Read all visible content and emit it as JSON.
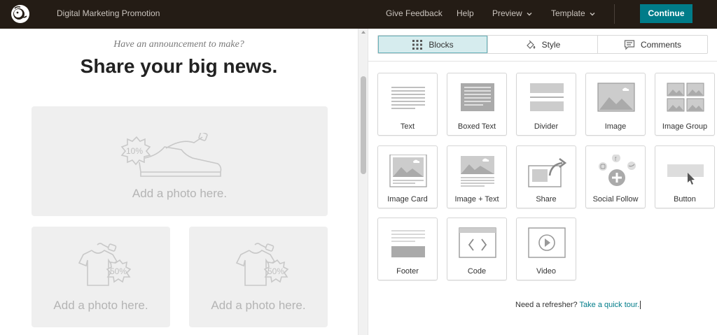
{
  "topbar": {
    "logo_icon": "mailchimp-logo-icon",
    "app_title": "Digital Marketing Promotion",
    "nav": {
      "give_feedback": "Give Feedback",
      "help": "Help",
      "preview": "Preview",
      "template": "Template"
    },
    "continue_label": "Continue",
    "accent": "#007c89",
    "background": "#241c15"
  },
  "preview": {
    "announcement": "Have an announcement to make?",
    "headline": "Share your big news.",
    "photo_hero_label": "Add a photo here.",
    "photo_left_label": "Add a photo here.",
    "photo_right_label": "Add a photo here.",
    "hero_tag": "10%",
    "shirt_tag": "50%"
  },
  "panel": {
    "tabs": [
      {
        "label": "Blocks",
        "icon": "grid-icon",
        "active": true
      },
      {
        "label": "Style",
        "icon": "paint-bucket-icon",
        "active": false
      },
      {
        "label": "Comments",
        "icon": "comment-icon",
        "active": false
      }
    ],
    "blocks": [
      {
        "label": "Text",
        "icon": "text-block-icon"
      },
      {
        "label": "Boxed Text",
        "icon": "boxed-text-block-icon"
      },
      {
        "label": "Divider",
        "icon": "divider-block-icon"
      },
      {
        "label": "Image",
        "icon": "image-block-icon"
      },
      {
        "label": "Image Group",
        "icon": "image-group-block-icon"
      },
      {
        "label": "Image Card",
        "icon": "image-card-block-icon"
      },
      {
        "label": "Image + Text",
        "icon": "image-text-block-icon"
      },
      {
        "label": "Share",
        "icon": "share-block-icon"
      },
      {
        "label": "Social Follow",
        "icon": "social-follow-block-icon"
      },
      {
        "label": "Button",
        "icon": "button-block-icon"
      },
      {
        "label": "Footer",
        "icon": "footer-block-icon"
      },
      {
        "label": "Code",
        "icon": "code-block-icon"
      },
      {
        "label": "Video",
        "icon": "video-block-icon"
      }
    ],
    "refresher_text": "Need a refresher?",
    "tour_link": "Take a quick tour."
  }
}
